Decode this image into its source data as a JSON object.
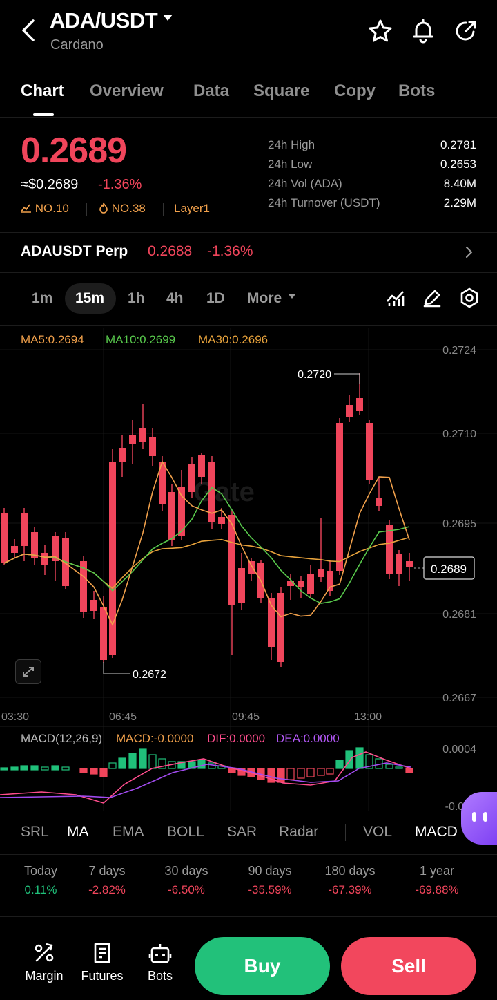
{
  "header": {
    "pair": "ADA/USDT",
    "name": "Cardano",
    "icons": [
      "back-icon",
      "star-icon",
      "bell-icon",
      "share-icon"
    ]
  },
  "tabs": [
    "Chart",
    "Overview",
    "Data",
    "Square",
    "Copy",
    "Bots"
  ],
  "ticker": {
    "last_price": "0.2689",
    "usd_price": "≈$0.2689",
    "change": "-1.36%",
    "tags": [
      "NO.10",
      "NO.38",
      "Layer1"
    ],
    "stats": [
      {
        "label": "24h  High",
        "value": "0.2781"
      },
      {
        "label": "24h  Low",
        "value": "0.2653"
      },
      {
        "label": "24h  Vol (ADA)",
        "value": "8.40M"
      },
      {
        "label": "24h  Turnover (USDT)",
        "value": "2.29M"
      }
    ]
  },
  "perp": {
    "name": "ADAUSDT Perp",
    "price": "0.2688",
    "change": "-1.36%"
  },
  "intervals": [
    "1m",
    "15m",
    "1h",
    "4h",
    "1D",
    "More"
  ],
  "selected_interval": "15m",
  "chart": {
    "ma_legend": {
      "ma5": "MA5:0.2694",
      "ma10": "MA10:0.2699",
      "ma30": "MA30:0.2696"
    },
    "y_ticks": [
      "0.2724",
      "0.2710",
      "0.2695",
      "0.2681",
      "0.2667"
    ],
    "x_ticks": [
      "03:30",
      "06:45",
      "09:45",
      "13:00"
    ],
    "high_label": "0.2720",
    "low_label": "0.2672",
    "current_label": "0.2689",
    "watermark": "Gate",
    "macd_legend": {
      "title": "MACD(12,26,9)",
      "macd": "MACD:-0.0000",
      "dif": "DIF:0.0000",
      "dea": "DEA:0.0000"
    },
    "macd_ticks": [
      "0.0004",
      "-0.000"
    ],
    "colors": {
      "up": "#20c07a",
      "down": "#f0455b",
      "ma5": "#f0a04b",
      "ma10": "#58c94c",
      "ma30": "#e8a33c",
      "dif": "#ff4d8d",
      "dea": "#a24bf0"
    }
  },
  "indicators": [
    "SRL",
    "MA",
    "EMA",
    "BOLL",
    "SAR",
    "Radar",
    "VOL",
    "MACD"
  ],
  "active_indicators": [
    "MA",
    "MACD"
  ],
  "performance": [
    {
      "label": "Today",
      "value": "0.11%",
      "up": true
    },
    {
      "label": "7 days",
      "value": "-2.82%",
      "up": false
    },
    {
      "label": "30 days",
      "value": "-6.50%",
      "up": false
    },
    {
      "label": "90 days",
      "value": "-35.59%",
      "up": false
    },
    {
      "label": "180 days",
      "value": "-67.39%",
      "up": false
    },
    {
      "label": "1 year",
      "value": "-69.88%",
      "up": false
    }
  ],
  "bottom_nav": [
    {
      "label": "Margin",
      "icon": "margin-icon"
    },
    {
      "label": "Futures",
      "icon": "futures-icon"
    },
    {
      "label": "Bots",
      "icon": "bots-icon"
    }
  ],
  "actions": {
    "buy": "Buy",
    "sell": "Sell"
  }
}
